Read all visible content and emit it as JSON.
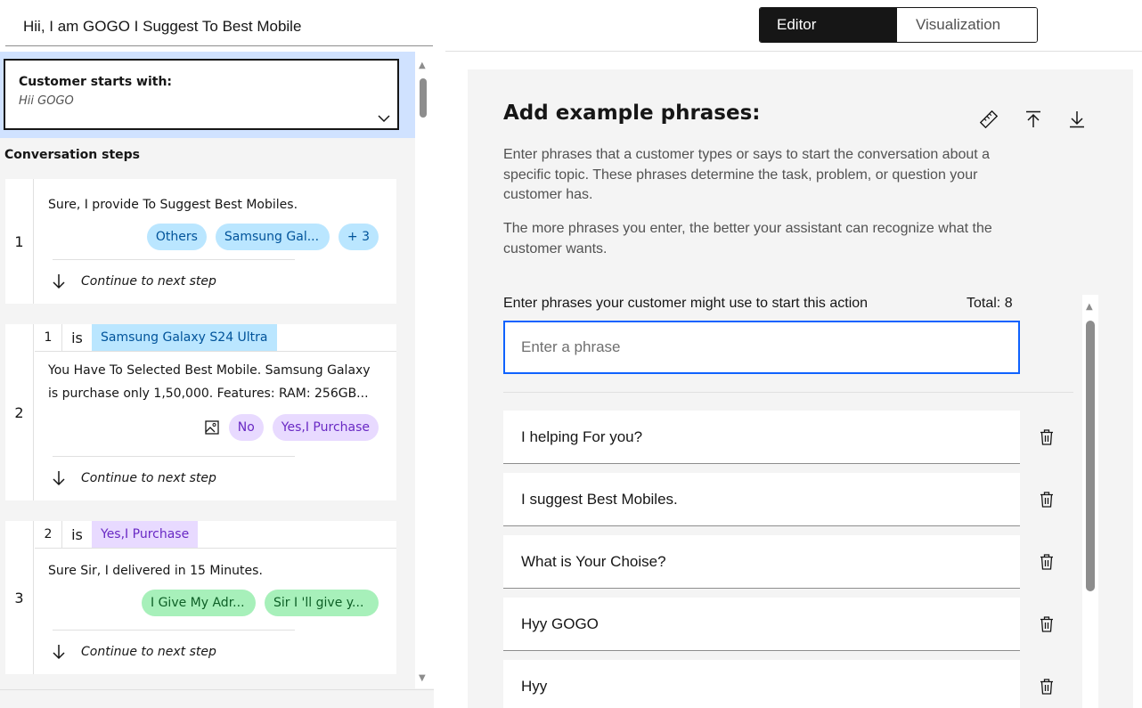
{
  "header": {
    "action_name": "Hii, I am GOGO I Suggest To Best Mobile",
    "tabs": [
      {
        "label": "Editor",
        "active": true
      },
      {
        "label": "Visualization",
        "active": false
      }
    ]
  },
  "left_pane": {
    "starter": {
      "label": "Customer starts with:",
      "value": "Hii GOGO"
    },
    "steps_heading": "Conversation steps",
    "steps": [
      {
        "number": "1",
        "text": "Sure, I provide To Suggest Best Mobiles.",
        "chips": [
          "Others",
          "Samsung Gal...",
          "+ 3"
        ],
        "next": "Continue to next step"
      },
      {
        "number": "2",
        "condition": {
          "step": "1",
          "operator": "is",
          "value": "Samsung Galaxy S24 Ultra"
        },
        "text_line1": "You Have To Selected Best Mobile. Samsung Galaxy",
        "text_line2": "is purchase only 1,50,000. Features: RAM: 256GB...",
        "chips": [
          "No",
          "Yes,I Purchase"
        ],
        "next": "Continue to next step"
      },
      {
        "number": "3",
        "condition": {
          "step": "2",
          "operator": "is",
          "value": "Yes,I Purchase"
        },
        "text": "Sure Sir, I delivered in 15 Minutes.",
        "chips": [
          "I Give My Adr...",
          "Sir I 'll give y..."
        ],
        "next": "Continue to next step"
      }
    ]
  },
  "panel": {
    "title": "Add example phrases:",
    "description1": "Enter phrases that a customer types or says to start the conversation about a specific topic. These phrases determine the task, problem, or question your customer has.",
    "description2": "The more phrases you enter, the better your assistant can recognize what the customer wants.",
    "input_label": "Enter phrases your customer might use to start this action",
    "total": "Total: 8",
    "input_placeholder": "Enter a phrase",
    "input_value": "",
    "phrases": [
      "I helping For you?",
      "I suggest Best Mobiles.",
      "What is Your Choise?",
      "Hyy GOGO",
      "Hyy"
    ]
  },
  "colors": {
    "accent_blue": "#0f62fe",
    "chip_blue": "#bae6ff",
    "chip_purple": "#e8daff",
    "chip_green": "#a7f0ba",
    "selection_bg": "#d0e2ff"
  },
  "icons": [
    "chevron-down-icon",
    "arrow-down-icon",
    "image-icon",
    "ruler-icon",
    "upload-icon",
    "download-icon",
    "trash-icon"
  ]
}
